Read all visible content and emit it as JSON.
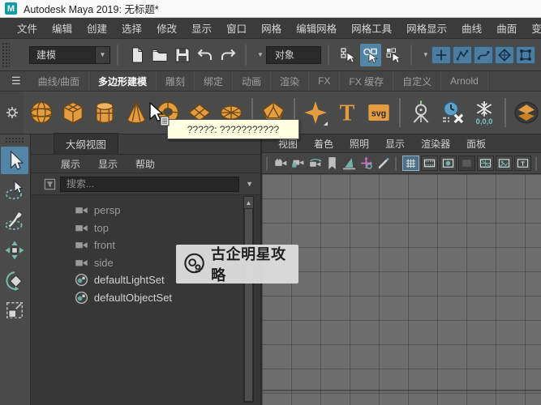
{
  "title_bar": {
    "app_title": "Autodesk Maya 2019: 无标题*",
    "logo_letter": "M"
  },
  "menu_bar": {
    "items": [
      "文件",
      "编辑",
      "创建",
      "选择",
      "修改",
      "显示",
      "窗口",
      "网格",
      "编辑网格",
      "网格工具",
      "网格显示",
      "曲线",
      "曲面",
      "变形"
    ]
  },
  "status_line": {
    "menu_set_value": "建模",
    "selection_mask_value": "对象",
    "file_icons": [
      {
        "name": "new-scene-icon",
        "sym": "newfile"
      },
      {
        "name": "open-scene-icon",
        "sym": "folder"
      },
      {
        "name": "save-scene-icon",
        "sym": "floppy"
      },
      {
        "name": "undo-icon",
        "sym": "undo"
      },
      {
        "name": "redo-icon",
        "sym": "redo"
      }
    ],
    "select_mode_icons": [
      {
        "name": "select-by-hierarchy-icon",
        "sym": "selh",
        "active": false
      },
      {
        "name": "select-by-object-icon",
        "sym": "selo",
        "active": true
      },
      {
        "name": "select-by-component-icon",
        "sym": "selc",
        "active": false
      }
    ],
    "snap_icons": [
      {
        "name": "snap-to-grid-icon",
        "sym": "snplus"
      },
      {
        "name": "snap-to-points-icon",
        "sym": "snpoly"
      },
      {
        "name": "snap-to-curves-icon",
        "sym": "sncurve"
      },
      {
        "name": "snap-to-planes-icon",
        "sym": "snface"
      },
      {
        "name": "live-surface-icon",
        "sym": "snlive"
      }
    ]
  },
  "shelf": {
    "tabs": [
      {
        "label": "曲线/曲面",
        "active": false
      },
      {
        "label": "多边形建模",
        "active": true
      },
      {
        "label": "雕刻",
        "active": false
      },
      {
        "label": "绑定",
        "active": false
      },
      {
        "label": "动画",
        "active": false
      },
      {
        "label": "渲染",
        "active": false
      },
      {
        "label": "FX",
        "active": false
      },
      {
        "label": "FX 缓存",
        "active": false
      },
      {
        "label": "自定义",
        "active": false
      },
      {
        "label": "Arnold",
        "active": false
      }
    ],
    "icons": [
      {
        "name": "poly-sphere-icon",
        "sym": "sphere"
      },
      {
        "name": "poly-cube-icon",
        "sym": "cube"
      },
      {
        "name": "poly-cylinder-icon",
        "sym": "cylinder"
      },
      {
        "name": "poly-cone-icon",
        "sym": "cone"
      },
      {
        "name": "poly-torus-icon",
        "sym": "torus"
      },
      {
        "name": "poly-plane-icon",
        "sym": "plane"
      },
      {
        "name": "poly-disc-icon",
        "sym": "disc"
      },
      {
        "sep": true
      },
      {
        "name": "platonic-solid-icon",
        "sym": "platonic",
        "corner": true
      },
      {
        "sep": true
      },
      {
        "name": "super-shape-icon",
        "sym": "sparkle",
        "corner": true
      },
      {
        "name": "type-tool-icon",
        "sym": "typeT"
      },
      {
        "name": "svg-tool-icon",
        "sym": "svgbadge"
      },
      {
        "sep": true
      },
      {
        "name": "center-pivot-icon",
        "sym": "pivot"
      },
      {
        "name": "delete-history-icon",
        "sym": "history"
      },
      {
        "name": "freeze-transform-icon",
        "sym": "freeze"
      },
      {
        "sep": true
      },
      {
        "name": "smooth-mesh-icon",
        "sym": "layers"
      }
    ]
  },
  "tooltip": {
    "text": "?????: ???????????"
  },
  "toolbox": {
    "tools": [
      {
        "name": "select-tool-icon",
        "sym": "select",
        "active": true
      },
      {
        "name": "lasso-tool-icon",
        "sym": "lasso",
        "active": false
      },
      {
        "name": "paint-select-tool-icon",
        "sym": "paint",
        "active": false
      },
      {
        "name": "move-tool-icon",
        "sym": "move",
        "active": false
      },
      {
        "name": "rotate-tool-icon",
        "sym": "rotate",
        "active": false
      },
      {
        "name": "scale-tool-icon",
        "sym": "scale",
        "active": false
      }
    ]
  },
  "outliner": {
    "tab_label": "大纲视图",
    "menus": [
      "展示",
      "显示",
      "帮助"
    ],
    "search_placeholder": "搜索...",
    "items": [
      {
        "label": "persp",
        "icon": "camera-icon",
        "dim": true
      },
      {
        "label": "top",
        "icon": "camera-icon",
        "dim": true
      },
      {
        "label": "front",
        "icon": "camera-icon",
        "dim": true
      },
      {
        "label": "side",
        "icon": "camera-icon",
        "dim": true
      },
      {
        "label": "defaultLightSet",
        "icon": "object-set-icon",
        "dim": false
      },
      {
        "label": "defaultObjectSet",
        "icon": "object-set-icon",
        "dim": false
      }
    ]
  },
  "viewport": {
    "menus": [
      "视图",
      "着色",
      "照明",
      "显示",
      "渲染器",
      "面板"
    ],
    "toolbar_icons": [
      {
        "sep": true
      },
      {
        "name": "camera-icon",
        "sym": "vcam"
      },
      {
        "name": "camera-lock-icon",
        "sym": "vcamlock"
      },
      {
        "name": "camera-orbit-icon",
        "sym": "vcamorbit"
      },
      {
        "name": "bookmark-icon",
        "sym": "vbookmark"
      },
      {
        "name": "image-plane-icon",
        "sym": "vlight"
      },
      {
        "name": "pan-zoom-icon",
        "sym": "vaxis"
      },
      {
        "name": "grease-pencil-icon",
        "sym": "vpencil"
      },
      {
        "sep": true
      },
      {
        "name": "grid-toggle-icon",
        "sym": "bgrid",
        "boxed": true,
        "active": true
      },
      {
        "name": "film-gate-icon",
        "sym": "bfilm",
        "boxed": true
      },
      {
        "name": "resolution-gate-icon",
        "sym": "bres",
        "boxed": true
      },
      {
        "name": "gate-mask-icon",
        "sym": "bmask",
        "boxed": true,
        "dim": true
      },
      {
        "name": "field-chart-icon",
        "sym": "bchart",
        "boxed": true
      },
      {
        "name": "safe-action-icon",
        "sym": "bimage",
        "boxed": true
      },
      {
        "name": "safe-title-icon",
        "sym": "btitle",
        "boxed": true
      },
      {
        "sep": true
      }
    ]
  },
  "watermark": {
    "text": "古企明星攻略"
  },
  "colors": {
    "accent_orange": "#e39c3f",
    "highlight_blue": "#5285a6",
    "snap_button_blue": "#4d7ca1",
    "tooltip_bg": "#ffffe1",
    "viewport_bg": "#6d6d6d",
    "panel_bg": "#4a4a4a",
    "outliner_bg": "#373737"
  }
}
